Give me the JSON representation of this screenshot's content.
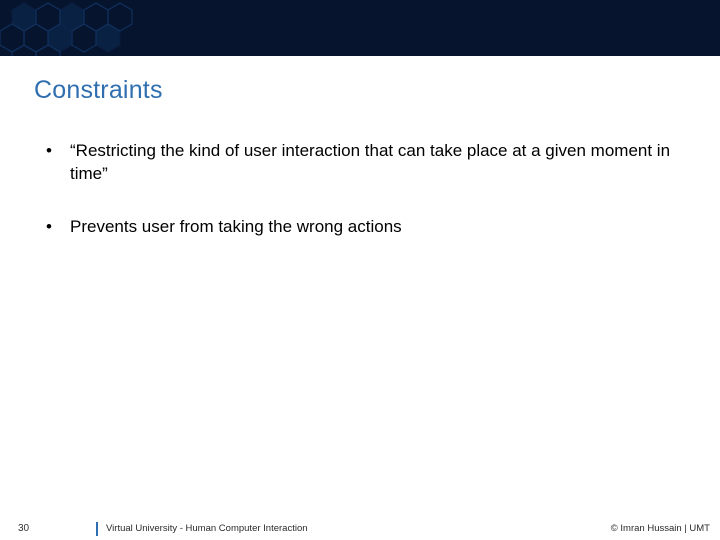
{
  "title": "Constraints",
  "bullets": [
    "“Restricting the kind of user interaction that can take place at a given moment in time”",
    "Prevents user from taking the wrong actions"
  ],
  "footer": {
    "page": "30",
    "course": "Virtual University - Human Computer Interaction",
    "copyright": "© Imran Hussain | UMT"
  }
}
